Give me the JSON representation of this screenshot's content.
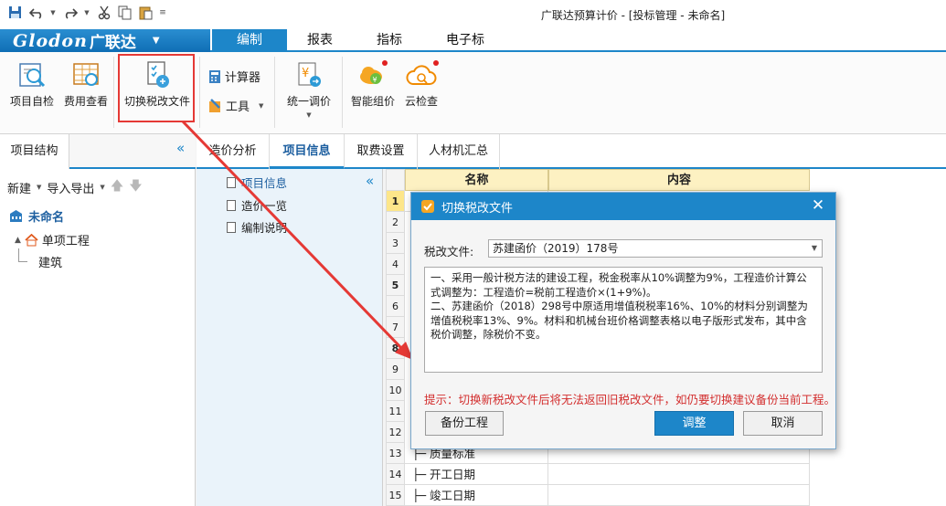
{
  "window": {
    "title": "广联达预算计价 - [投标管理 - 未命名]"
  },
  "logo": {
    "brand": "Glodon",
    "cn": "广联达"
  },
  "menu": {
    "tabs": [
      "编制",
      "报表",
      "指标",
      "电子标"
    ],
    "active": 0
  },
  "ribbon": {
    "project_check": "项目自检",
    "fee_view": "费用查看",
    "switch_tax": "切换税改文件",
    "calculator": "计算器",
    "tools": "工具",
    "unified_price": "统一调价",
    "smart_price": "智能组价",
    "cloud_check": "云检查"
  },
  "left_panel": {
    "tab": "项目结构",
    "new": "新建",
    "import_export": "导入导出",
    "root": "未命名",
    "child": "单项工程",
    "leaf": "建筑"
  },
  "nav_tabs": [
    "造价分析",
    "项目信息",
    "取费设置",
    "人材机汇总"
  ],
  "nav_active": 1,
  "sub_tree": [
    "项目信息",
    "造价一览",
    "编制说明"
  ],
  "grid": {
    "headers": [
      "名称",
      "内容"
    ],
    "row_numbers": [
      "1",
      "2",
      "3",
      "4",
      "5",
      "6",
      "7",
      "8",
      "9",
      "10",
      "11",
      "12",
      "13",
      "14",
      "15"
    ],
    "visible_rows": [
      {
        "no": "13",
        "name": "质量标准"
      },
      {
        "no": "14",
        "name": "开工日期"
      },
      {
        "no": "15",
        "name": "竣工日期"
      }
    ]
  },
  "dialog": {
    "title": "切换税改文件",
    "tax_label": "税改文件:",
    "tax_value": "苏建函价（2019）178号",
    "description": "一、采用一般计税方法的建设工程，税金税率从10%调整为9%，工程造价计算公式调整为：工程造价=税前工程造价×(1+9%)。\n二、苏建函价（2018）298号中原适用增值税税率16%、10%的材料分别调整为增值税税率13%、9%。材料和机械台班价格调整表格以电子版形式发布，其中含税价调整，除税价不变。",
    "hint": "提示：切换新税改文件后将无法返回旧税改文件，如仍要切换建议备份当前工程。",
    "backup": "备份工程",
    "adjust": "调整",
    "cancel": "取消"
  },
  "colors": {
    "accent": "#1d86c9",
    "highlight": "#e53935",
    "hint": "#d32f2f"
  }
}
